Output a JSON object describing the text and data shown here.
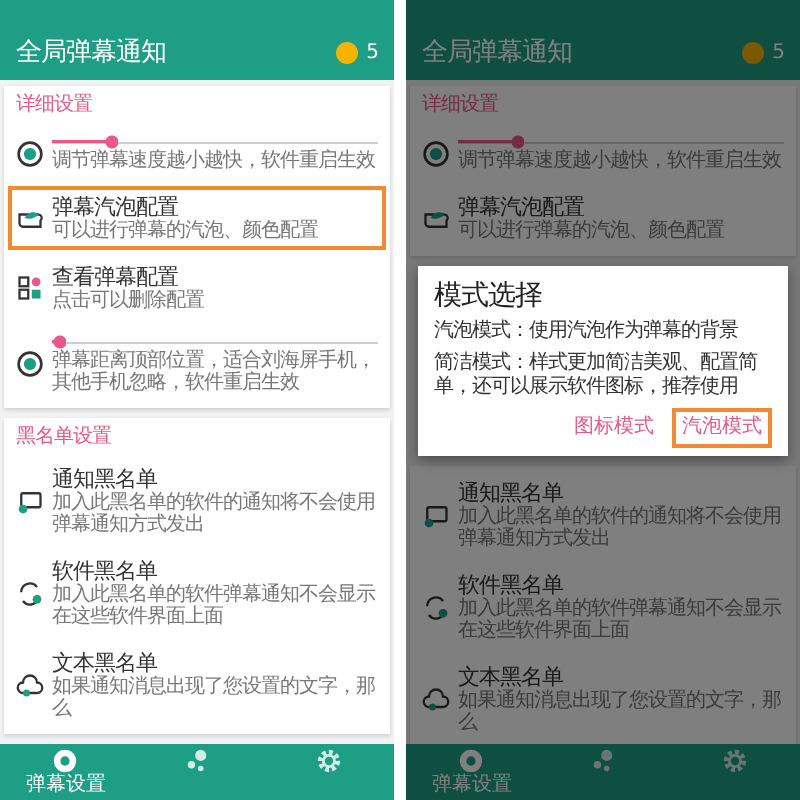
{
  "phones": [
    {
      "dimmed": false,
      "app_bar": {
        "title": "全局弹幕通知",
        "coins": "5"
      },
      "blocks": [
        {
          "kind": "card",
          "items": [
            {
              "kind": "section",
              "text": "详细设置"
            },
            {
              "kind": "slider",
              "level": 0.2,
              "description": "调节弹幕速度越小越快，软件重启生效"
            },
            {
              "kind": "entry",
              "title": "弹幕汽泡配置",
              "description": "可以进行弹幕的汽泡、颜色配置",
              "highlighted": true
            },
            {
              "kind": "entry",
              "title": "查看弹幕配置",
              "description": "点击可以删除配置",
              "highlighted": false
            },
            {
              "kind": "slider",
              "level": 0.02,
              "description": "弹幕距离顶部位置，适合刘海屏手机，其他手机忽略，软件重启生效"
            }
          ]
        },
        {
          "kind": "card",
          "items": [
            {
              "kind": "section",
              "text": "黑名单设置"
            },
            {
              "kind": "entry",
              "title": "通知黑名单",
              "description": "加入此黑名单的软件的通知将不会使用弹幕通知方式发出",
              "highlighted": false
            },
            {
              "kind": "entry",
              "title": "软件黑名单",
              "description": "加入此黑名单的软件弹幕通知不会显示在这些软件界面上面",
              "highlighted": false
            },
            {
              "kind": "entry",
              "title": "文本黑名单",
              "description": "如果通知消息出现了您设置的文字，那么",
              "highlighted": false
            }
          ]
        }
      ],
      "bottom_nav": [
        {
          "label": "弹幕设置",
          "selected": true
        },
        {
          "selected": false
        },
        {
          "selected": false
        }
      ]
    },
    {
      "dimmed": true,
      "app_bar": {
        "title": "全局弹幕通知",
        "coins": "5"
      },
      "blocks": [
        {
          "kind": "card",
          "items": [
            {
              "kind": "section",
              "text": "详细设置"
            },
            {
              "kind": "slider",
              "level": 0.2,
              "description": "调节弹幕速度越小越快，软件重启生效"
            },
            {
              "kind": "entry",
              "title": "弹幕汽泡配置",
              "description": "可以进行弹幕的汽泡、颜色配置",
              "highlighted": false
            }
          ]
        },
        {
          "kind": "dialog",
          "title": "模式选择",
          "paragraphs": [
            "汽泡模式：使用汽泡作为弹幕的背景",
            "简洁模式：样式更加简洁美观、配置简单，还可以展示软件图标，推荐使用"
          ],
          "buttons": [
            {
              "label": "图标模式",
              "highlighted": false
            },
            {
              "label": "汽泡模式",
              "highlighted": true
            }
          ]
        },
        {
          "kind": "card",
          "items": [
            {
              "kind": "entry",
              "title": "通知黑名单",
              "description": "加入此黑名单的软件的通知将不会使用弹幕通知方式发出",
              "highlighted": false
            },
            {
              "kind": "entry",
              "title": "软件黑名单",
              "description": "加入此黑名单的软件弹幕通知不会显示在这些软件界面上面",
              "highlighted": false
            },
            {
              "kind": "entry",
              "title": "文本黑名单",
              "description": "如果通知消息出现了您设置的文字，那么",
              "highlighted": false
            }
          ]
        }
      ],
      "bottom_nav": [
        {
          "label": "弹幕设置",
          "selected": true
        },
        {
          "selected": false
        },
        {
          "selected": false
        }
      ]
    }
  ]
}
